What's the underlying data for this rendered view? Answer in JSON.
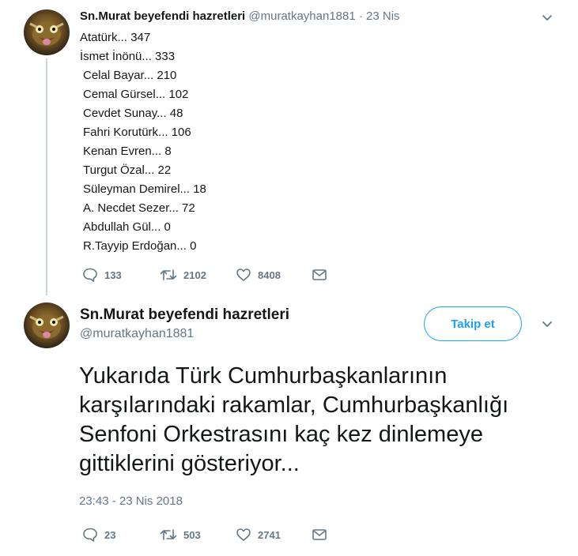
{
  "tweet1": {
    "name": "Sn.Murat beyefendi hazretleri",
    "meta": "@muratkayhan1881 · 23 Nis",
    "lines": [
      "Atatürk... 347",
      "İsmet İnönü... 333",
      " Celal Bayar... 210",
      " Cemal Gürsel... 102",
      " Cevdet Sunay... 48",
      " Fahri Korutürk... 106",
      " Kenan Evren... 8",
      " Turgut Özal... 22",
      " Süleyman Demirel... 18",
      " A. Necdet Sezer... 72",
      " Abdullah Gül... 0",
      " R.Tayyip Erdoğan... 0"
    ],
    "replies": "133",
    "retweets": "2102",
    "likes": "8408"
  },
  "tweet2": {
    "name": "Sn.Murat beyefendi hazretleri",
    "handle": "@muratkayhan1881",
    "follow_label": "Takip et",
    "text": "Yukarıda Türk Cumhurbaşkanlarının karşılarındaki rakamlar, Cumhurbaşkanlığı Senfoni Orkestrasını kaç kez dinlemeye gittiklerini gösteriyor...",
    "timestamp": "23:43 - 23 Nis 2018",
    "replies": "23",
    "retweets": "503",
    "likes": "2741"
  },
  "icons": {
    "reply": "reply-icon",
    "retweet": "retweet-icon",
    "like": "heart-icon",
    "dm": "envelope-icon",
    "more": "chevron-down-icon"
  },
  "colors": {
    "accent": "#1da1f2",
    "muted": "#657786",
    "text": "#14171a"
  }
}
